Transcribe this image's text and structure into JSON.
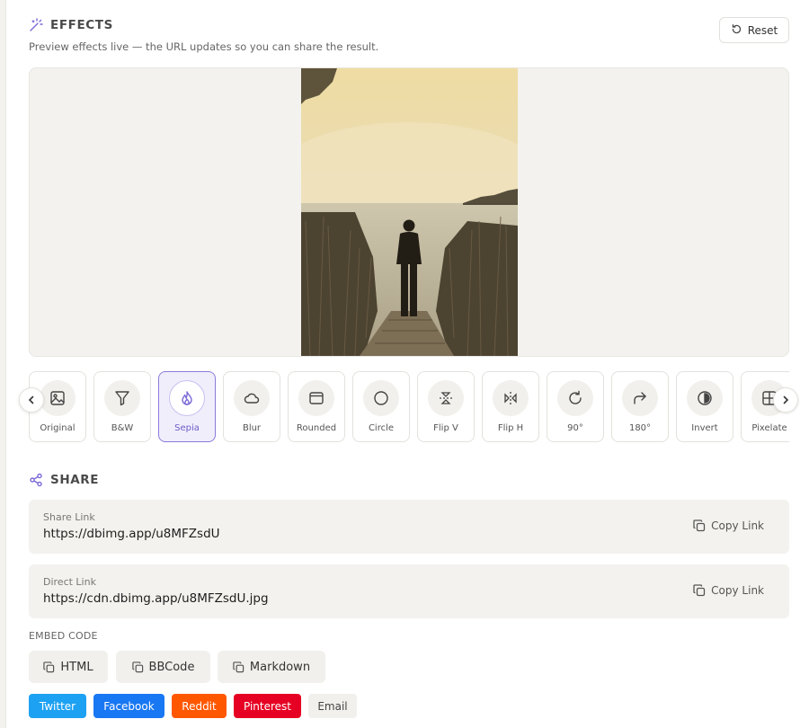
{
  "effects": {
    "title": "EFFECTS",
    "subtitle": "Preview effects live — the URL updates so you can share the result.",
    "reset_label": "Reset",
    "selected": "Sepia",
    "items": [
      {
        "label": "Original",
        "icon": "image-icon"
      },
      {
        "label": "B&W",
        "icon": "filter-icon"
      },
      {
        "label": "Sepia",
        "icon": "flame-icon"
      },
      {
        "label": "Blur",
        "icon": "cloud-icon"
      },
      {
        "label": "Rounded",
        "icon": "browser-window-icon"
      },
      {
        "label": "Circle",
        "icon": "circle-icon"
      },
      {
        "label": "Flip V",
        "icon": "flip-vertical-icon"
      },
      {
        "label": "Flip H",
        "icon": "flip-horizontal-icon"
      },
      {
        "label": "90°",
        "icon": "rotate-cw-icon"
      },
      {
        "label": "180°",
        "icon": "redo-arrow-icon"
      },
      {
        "label": "Invert",
        "icon": "contrast-icon"
      },
      {
        "label": "Pixelate",
        "icon": "grid-icon"
      }
    ]
  },
  "share": {
    "title": "SHARE",
    "share_link": {
      "caption": "Share Link",
      "url": "https://dbimg.app/u8MFZsdU",
      "copy_label": "Copy Link"
    },
    "direct_link": {
      "caption": "Direct Link",
      "url": "https://cdn.dbimg.app/u8MFZsdU.jpg",
      "copy_label": "Copy Link"
    },
    "embed": {
      "caption": "EMBED CODE",
      "buttons": [
        "HTML",
        "BBCode",
        "Markdown"
      ]
    },
    "social": [
      {
        "label": "Twitter",
        "color": "#1da1f2"
      },
      {
        "label": "Facebook",
        "color": "#1877f2"
      },
      {
        "label": "Reddit",
        "color": "#ff5700"
      },
      {
        "label": "Pinterest",
        "color": "#e60023"
      },
      {
        "label": "Email",
        "color": "#f1f0ec"
      }
    ]
  },
  "colors": {
    "accent": "#7b68d6",
    "panel": "#f3f2ee"
  }
}
